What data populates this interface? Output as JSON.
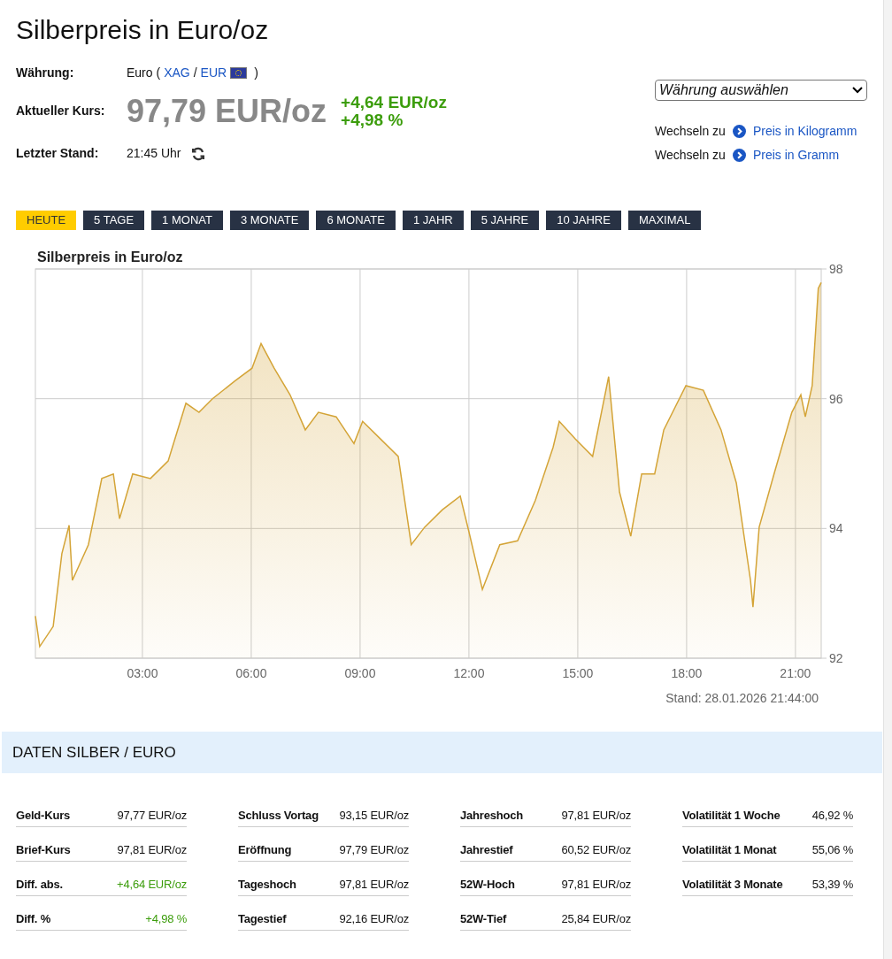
{
  "title": "Silberpreis in Euro/oz",
  "info": {
    "currency_label": "Währung:",
    "currency_name": "Euro",
    "currency_open": "(",
    "currency_code_1": "XAG",
    "currency_sep": "/",
    "currency_code_2": "EUR",
    "currency_close": ")",
    "price_label": "Aktueller Kurs:",
    "price": "97,79 EUR/oz",
    "change_abs": "+4,64 EUR/oz",
    "change_pct": "+4,98 %",
    "updated_label": "Letzter Stand:",
    "updated": "21:45 Uhr"
  },
  "currency_select": {
    "placeholder": "Währung auswählen"
  },
  "switch_links": [
    {
      "prefix": "Wechseln zu",
      "link": "Preis in Kilogramm"
    },
    {
      "prefix": "Wechseln zu",
      "link": "Preis in Gramm"
    }
  ],
  "ranges": [
    {
      "label": "HEUTE",
      "selected": true
    },
    {
      "label": "5 TAGE",
      "selected": false
    },
    {
      "label": "1 MONAT",
      "selected": false
    },
    {
      "label": "3 MONATE",
      "selected": false
    },
    {
      "label": "6 MONATE",
      "selected": false
    },
    {
      "label": "1 JAHR",
      "selected": false
    },
    {
      "label": "5 JAHRE",
      "selected": false
    },
    {
      "label": "10 JAHRE",
      "selected": false
    },
    {
      "label": "MAXIMAL",
      "selected": false
    }
  ],
  "chart": {
    "stand": "Stand: 28.01.2026 21:44:00",
    "chart_data": {
      "type": "area",
      "title": "Silberpreis in Euro/oz",
      "x": [
        0.05,
        0.17,
        0.54,
        0.78,
        0.98,
        1.07,
        1.51,
        1.88,
        2.2,
        2.37,
        2.73,
        3.22,
        3.71,
        4.2,
        4.56,
        4.93,
        5.54,
        6.02,
        6.27,
        6.63,
        7.07,
        7.49,
        7.85,
        8.34,
        8.83,
        9.07,
        9.56,
        10.05,
        10.41,
        10.78,
        11.27,
        11.76,
        12.0,
        12.37,
        12.85,
        13.34,
        13.83,
        14.32,
        14.49,
        14.93,
        15.41,
        15.85,
        16.15,
        16.46,
        16.76,
        17.12,
        17.37,
        17.98,
        18.46,
        18.95,
        19.37,
        19.76,
        19.83,
        20.0,
        20.41,
        20.9,
        21.15,
        21.27,
        21.46,
        21.63,
        21.71
      ],
      "grid": true,
      "series": [
        {
          "color": "#d4a437",
          "values": [
            92.65,
            92.18,
            92.49,
            93.61,
            94.05,
            93.2,
            93.75,
            94.77,
            94.84,
            94.15,
            94.84,
            94.77,
            95.04,
            95.93,
            95.79,
            96.0,
            96.27,
            96.47,
            96.85,
            96.47,
            96.06,
            95.52,
            95.79,
            95.72,
            95.31,
            95.65,
            95.38,
            95.11,
            93.75,
            94.02,
            94.29,
            94.5,
            93.95,
            93.06,
            93.75,
            93.81,
            94.43,
            95.25,
            95.65,
            95.38,
            95.11,
            96.34,
            94.56,
            93.88,
            94.84,
            94.84,
            95.52,
            96.2,
            96.13,
            95.52,
            94.7,
            93.2,
            92.79,
            94.02,
            94.84,
            95.79,
            96.06,
            95.72,
            96.2,
            97.7,
            97.79
          ]
        }
      ],
      "xlim": [
        0.05,
        21.71
      ],
      "ylim": [
        92,
        98
      ],
      "xticks": [
        {
          "value": 3,
          "label": "03:00"
        },
        {
          "value": 6,
          "label": "06:00"
        },
        {
          "value": 9,
          "label": "09:00"
        },
        {
          "value": 12,
          "label": "12:00"
        },
        {
          "value": 15,
          "label": "15:00"
        },
        {
          "value": 18,
          "label": "18:00"
        },
        {
          "value": 21,
          "label": "21:00"
        }
      ],
      "yticks": [
        92,
        94,
        96,
        98
      ]
    }
  },
  "data_section": {
    "heading": "DATEN SILBER / EURO",
    "columns": [
      [
        {
          "label": "Geld-Kurs",
          "value": "97,77 EUR/oz",
          "positive": false
        },
        {
          "label": "Brief-Kurs",
          "value": "97,81 EUR/oz",
          "positive": false
        },
        {
          "label": "Diff. abs.",
          "value": "+4,64 EUR/oz",
          "positive": true
        },
        {
          "label": "Diff. %",
          "value": "+4,98 %",
          "positive": true
        }
      ],
      [
        {
          "label": "Schluss Vortag",
          "value": "93,15 EUR/oz",
          "positive": false
        },
        {
          "label": "Eröffnung",
          "value": "97,79 EUR/oz",
          "positive": false
        },
        {
          "label": "Tageshoch",
          "value": "97,81 EUR/oz",
          "positive": false
        },
        {
          "label": "Tagestief",
          "value": "92,16 EUR/oz",
          "positive": false
        }
      ],
      [
        {
          "label": "Jahreshoch",
          "value": "97,81 EUR/oz",
          "positive": false
        },
        {
          "label": "Jahrestief",
          "value": "60,52 EUR/oz",
          "positive": false
        },
        {
          "label": "52W-Hoch",
          "value": "97,81 EUR/oz",
          "positive": false
        },
        {
          "label": "52W-Tief",
          "value": "25,84 EUR/oz",
          "positive": false
        }
      ],
      [
        {
          "label": "Volatilität 1 Woche",
          "value": "46,92 %",
          "positive": false
        },
        {
          "label": "Volatilität 1 Monat",
          "value": "55,06 %",
          "positive": false
        },
        {
          "label": "Volatilität 3 Monate",
          "value": "53,39 %",
          "positive": false
        }
      ]
    ]
  }
}
